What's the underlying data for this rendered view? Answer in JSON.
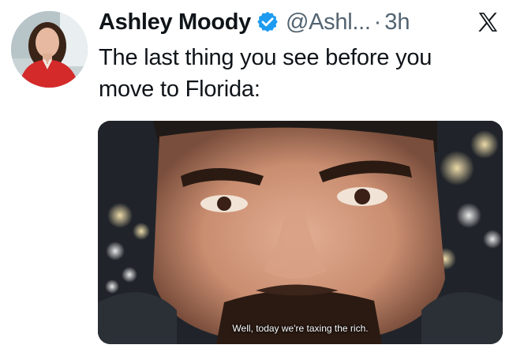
{
  "tweet": {
    "author_name": "Ashley Moody",
    "verified_icon": "verified-badge-icon",
    "handle": "@Ashl...",
    "separator": "·",
    "time": "3h",
    "platform_icon": "x-logo-icon",
    "text_line1": "The last thing you see before you",
    "text_line2": "move to Florida:",
    "media": {
      "caption": "Well, today we're taxing the rich."
    }
  },
  "colors": {
    "text": "#0f1419",
    "secondary": "#536471",
    "verified": "#1d9bf0",
    "avatar_jacket": "#d42a2a"
  }
}
